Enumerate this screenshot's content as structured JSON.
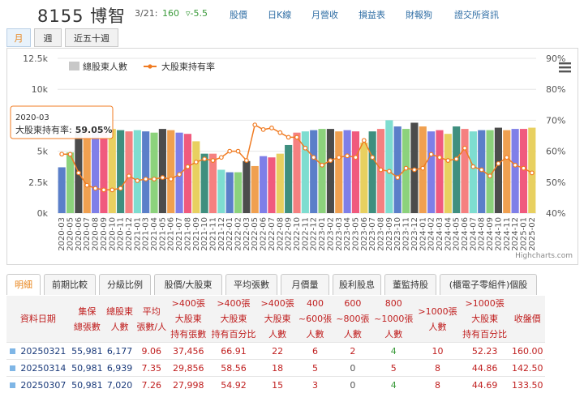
{
  "header": {
    "stock_title": "8155 博智",
    "date": "3/21:",
    "price": "160",
    "change": "▿-5.5",
    "nav": [
      "股價",
      "日K線",
      "月營收",
      "損益表",
      "財報狗",
      "證交所資訊"
    ]
  },
  "period_tabs": [
    "月",
    "週",
    "近五十週"
  ],
  "tooltip": {
    "title": "2020-03",
    "label": "大股東持有率:",
    "value": "59.05%"
  },
  "credit": "Highcharts.com",
  "colors": {
    "line": "#f07b22",
    "active_tab": "#e8861e",
    "header_red": "#c02020",
    "green": "#3a9a3a"
  },
  "chart_data": {
    "type": "bar",
    "categories": [
      "2020-03",
      "2020-05",
      "2020-06",
      "2020-07",
      "2020-08",
      "2020-09",
      "2020-10",
      "2020-11",
      "2020-12",
      "2021-01",
      "2021-03",
      "2021-04",
      "2021-05",
      "2021-06",
      "2021-07",
      "2021-08",
      "2021-09",
      "2021-10",
      "2021-11",
      "2021-12",
      "2022-01",
      "2022-02",
      "2022-03",
      "2022-05",
      "2022-06",
      "2022-07",
      "2022-08",
      "2022-09",
      "2022-10",
      "2022-11",
      "2022-12",
      "2023-01",
      "2023-02",
      "2023-03",
      "2023-04",
      "2023-05",
      "2023-06",
      "2023-07",
      "2023-08",
      "2023-09",
      "2023-10",
      "2023-11",
      "2023-12",
      "2024-01",
      "2024-02",
      "2024-03",
      "2024-04",
      "2024-05",
      "2024-06",
      "2024-07",
      "2024-08",
      "2024-09",
      "2024-10",
      "2024-11",
      "2024-12",
      "2025-01",
      "2025-02"
    ],
    "series": [
      {
        "name": "總股東人數",
        "axis": "left",
        "values": [
          3700,
          4900,
          6600,
          6800,
          6700,
          6700,
          6800,
          6700,
          6600,
          6700,
          6600,
          6500,
          6800,
          6700,
          6500,
          6400,
          5800,
          4800,
          4800,
          3500,
          3300,
          3300,
          4200,
          3800,
          4600,
          4500,
          4800,
          5500,
          6500,
          6600,
          6700,
          6800,
          6800,
          6600,
          6700,
          6600,
          5700,
          6600,
          6800,
          7500,
          7000,
          6800,
          7300,
          7000,
          6600,
          6700,
          6400,
          7000,
          6800,
          6600,
          6700,
          6700,
          6900,
          6700,
          6800,
          6800,
          6900,
          6600,
          6900,
          6900,
          6800
        ],
        "colors": [
          "#5b7fc9",
          "#8cd27c",
          "#4c4c4c",
          "#f0a050",
          "#7f7fe8",
          "#f05a7e",
          "#e8d060",
          "#3f8f7f",
          "#f58080",
          "#7eddd0",
          "#5b7fc9",
          "#8cd27c",
          "#4c4c4c",
          "#f0a050",
          "#7f7fe8",
          "#f05a7e",
          "#e8d060",
          "#3f8f7f",
          "#f58080",
          "#7eddd0"
        ]
      },
      {
        "name": "大股東持有率",
        "axis": "right",
        "values": [
          59.05,
          59,
          53,
          49,
          48,
          47.5,
          47.5,
          48,
          52,
          50.5,
          51,
          51,
          51.5,
          51,
          52.5,
          55,
          56.5,
          57.5,
          57,
          58,
          60,
          60,
          57,
          68.5,
          67,
          67.5,
          66,
          64.5,
          64.5,
          61,
          58,
          55.5,
          57,
          58,
          58.5,
          58,
          63.5,
          58,
          54,
          53.5,
          51.5,
          54.5,
          54,
          54.5,
          59,
          58,
          57,
          57.5,
          61,
          55,
          54,
          52,
          56,
          58,
          55.5,
          54.5,
          53,
          53
        ]
      }
    ],
    "left_axis": {
      "ticks": [
        "0k",
        "2.5k",
        "5k",
        "7.5k",
        "10k",
        "12.5k"
      ],
      "ylim": [
        0,
        12500
      ]
    },
    "right_axis": {
      "ticks": [
        "40%",
        "50%",
        "60%",
        "70%",
        "80%",
        "90%"
      ],
      "ylim": [
        40,
        90
      ]
    },
    "legend": "top-left"
  },
  "bottom_tabs": [
    "明細",
    "前期比較",
    "分級比例",
    "股價/大股東",
    "平均張數",
    "月價量",
    "股利股息",
    "董監持股",
    "(櫃電子零組件)個股"
  ],
  "table": {
    "headers": [
      [
        "資料日期"
      ],
      [
        "集保",
        "總張數"
      ],
      [
        "總股東",
        "人數"
      ],
      [
        "平均",
        "張數/人"
      ],
      [
        ">400張",
        "大股東",
        "持有張數"
      ],
      [
        ">400張",
        "大股東",
        "持有百分比"
      ],
      [
        ">400張",
        "大股東",
        "人數"
      ],
      [
        "400",
        "~600張",
        "人數"
      ],
      [
        "600",
        "~800張",
        "人數"
      ],
      [
        "800",
        "~1000張",
        "人數"
      ],
      [
        ">1000張",
        "人數"
      ],
      [
        ">1000張",
        "大股東",
        "持有百分比"
      ],
      [
        "收盤價"
      ]
    ],
    "rows": [
      [
        "20250321",
        "55,981",
        "6,177",
        "9.06",
        "37,456",
        "66.91",
        "22",
        "6",
        "2",
        "4",
        "10",
        "52.23",
        "160.00"
      ],
      [
        "20250314",
        "50,981",
        "6,939",
        "7.35",
        "29,856",
        "58.56",
        "18",
        "5",
        "0",
        "5",
        "8",
        "44.86",
        "142.50"
      ],
      [
        "20250307",
        "50,981",
        "7,020",
        "7.26",
        "27,998",
        "54.92",
        "15",
        "3",
        "0",
        "4",
        "8",
        "44.69",
        "133.50"
      ]
    ]
  }
}
